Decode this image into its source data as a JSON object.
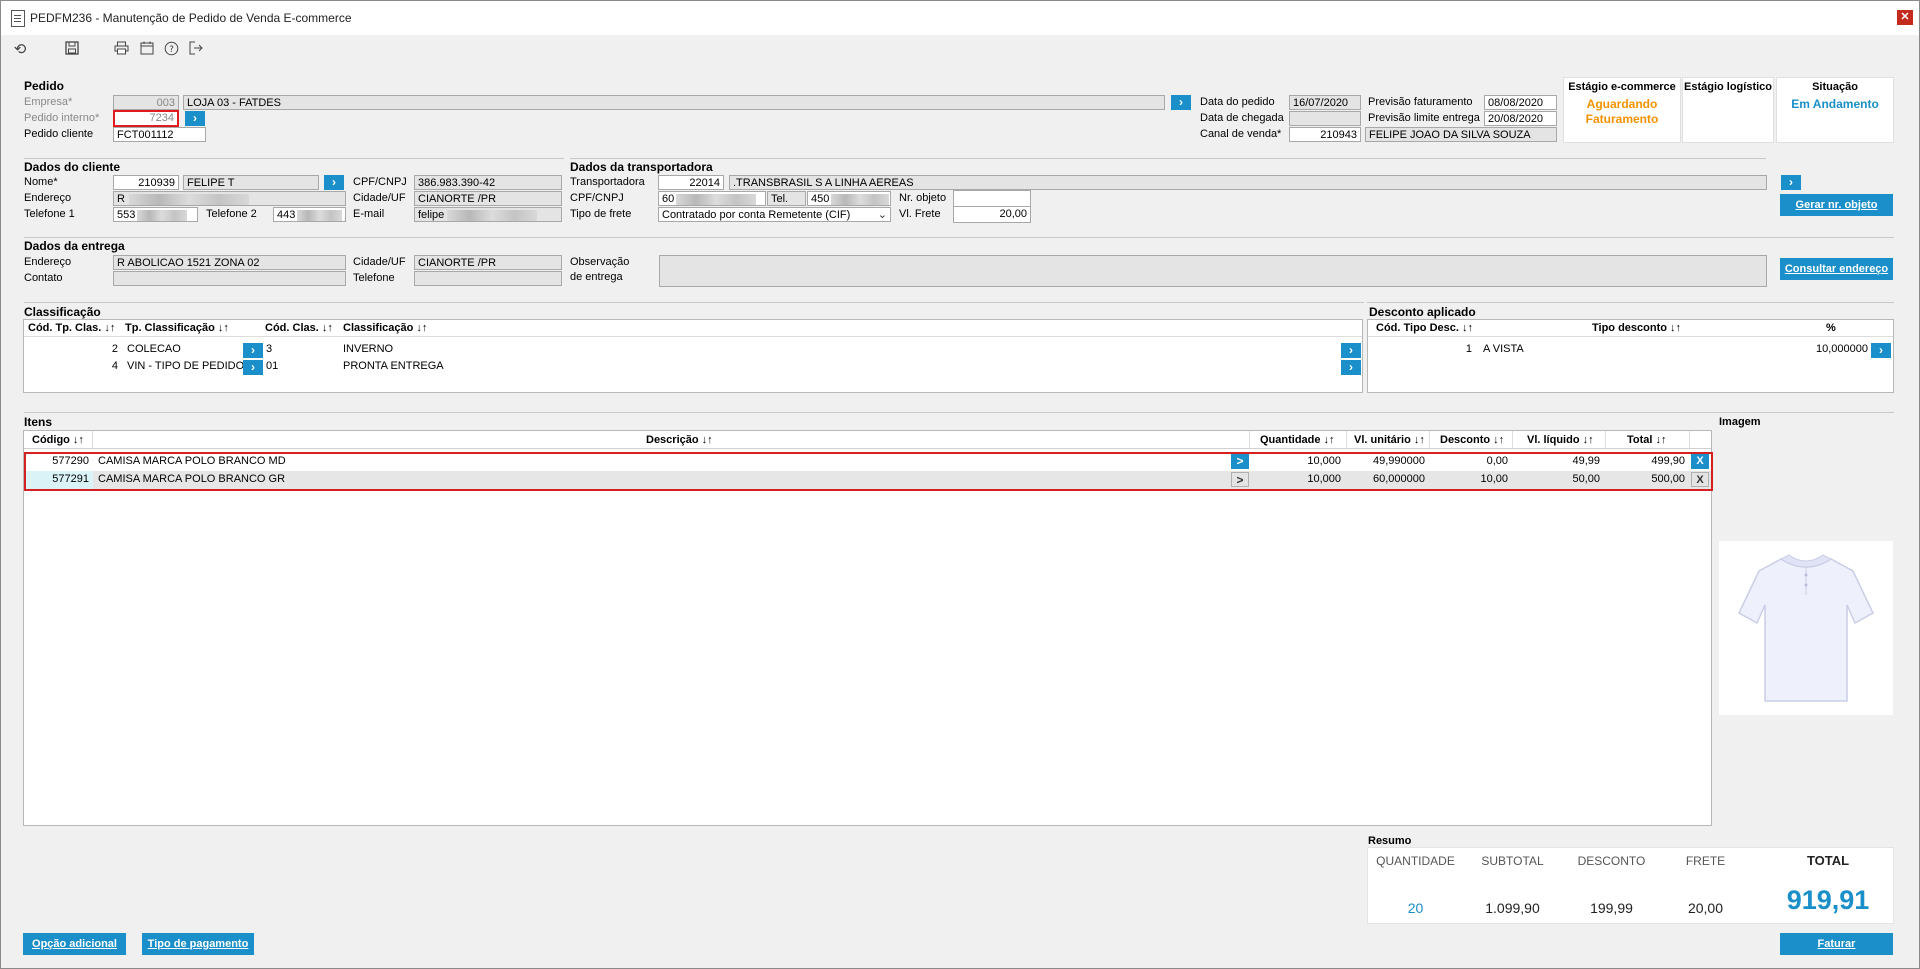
{
  "window": {
    "title": "PEDFM236 - Manutenção de Pedido de Venda E-commerce",
    "close_label": "✕"
  },
  "toolbar": [
    "refresh-icon",
    "save-icon",
    "print-icon",
    "calendar-icon",
    "help-icon",
    "exit-icon"
  ],
  "pedido": {
    "section": "Pedido",
    "empresa_label": "Empresa*",
    "empresa_code": "003",
    "empresa_name": "LOJA 03 - FATDES",
    "pedido_interno_label": "Pedido interno*",
    "pedido_interno": "7234",
    "pedido_cliente_label": "Pedido cliente",
    "pedido_cliente": "FCT001112",
    "data_pedido_label": "Data do pedido",
    "data_pedido": "16/07/2020",
    "data_chegada_label": "Data de chegada",
    "data_chegada": "",
    "canal_label": "Canal de venda*",
    "canal_code": "210943",
    "canal_name": "FELIPE JOAO DA SILVA SOUZA",
    "prev_fat_label": "Previsão faturamento",
    "prev_fat": "08/08/2020",
    "prev_limite_label": "Previsão limite entrega",
    "prev_limite": "20/08/2020"
  },
  "status": {
    "ecommerce_title": "Estágio e-commerce",
    "ecommerce_value_1": "Aguardando",
    "ecommerce_value_2": "Faturamento",
    "logistico_title": "Estágio logístico",
    "logistico_value": "",
    "situacao_title": "Situação",
    "situacao_value": "Em Andamento",
    "orange": "#f39200",
    "blue": "#1a8fc9"
  },
  "cliente": {
    "section": "Dados do cliente",
    "nome_label": "Nome*",
    "nome_code": "210939",
    "nome": "FELIPE T",
    "endereco_label": "Endereço",
    "endereco": "R",
    "tel1_label": "Telefone 1",
    "tel1": "553",
    "tel2_label": "Telefone 2",
    "tel2": "443",
    "cpf_label": "CPF/CNPJ",
    "cpf": "386.983.390-42",
    "cidade_label": "Cidade/UF",
    "cidade": "CIANORTE /PR",
    "email_label": "E-mail",
    "email": "felipe"
  },
  "transportadora": {
    "section": "Dados da transportadora",
    "transp_label": "Transportadora",
    "transp_code": "22014",
    "transp_name": ".TRANSBRASIL S A LINHA AEREAS",
    "cpf_label": "CPF/CNPJ",
    "cpf": "60",
    "tel_label": "Tel.",
    "tel": "450",
    "frete_label": "Tipo de frete",
    "frete": "Contratado por conta Remetente (CIF)",
    "nr_objeto_label": "Nr. objeto",
    "nr_objeto": "",
    "vl_frete_label": "Vl. Frete",
    "vl_frete": "20,00",
    "gerar_btn": "Gerar nr. objeto"
  },
  "entrega": {
    "section": "Dados da entrega",
    "endereco_label": "Endereço",
    "endereco": "R ABOLICAO 1521  ZONA 02",
    "contato_label": "Contato",
    "contato": "",
    "cidade_label": "Cidade/UF",
    "cidade": "CIANORTE /PR",
    "telefone_label": "Telefone",
    "telefone": "",
    "obs_label_1": "Observação",
    "obs_label_2": "de entrega",
    "obs": "",
    "consultar_btn": "Consultar endereço"
  },
  "classificacao": {
    "section": "Classificação",
    "headers": [
      "Cód. Tp. Clas. ↓↑",
      "Tp. Classificação ↓↑",
      "Cód. Clas. ↓↑",
      "Classificação ↓↑"
    ],
    "rows": [
      {
        "cod_tp": "2",
        "tp": "COLECAO",
        "cod": "3",
        "clas": "INVERNO"
      },
      {
        "cod_tp": "4",
        "tp": "VIN - TIPO DE PEDIDO",
        "cod": "01",
        "clas": "PRONTA ENTREGA"
      }
    ]
  },
  "desconto": {
    "section": "Desconto aplicado",
    "headers": [
      "Cód. Tipo Desc. ↓↑",
      "Tipo desconto ↓↑",
      "%"
    ],
    "rows": [
      {
        "cod": "1",
        "tipo": "A VISTA",
        "pct": "10,000000"
      }
    ]
  },
  "itens": {
    "section": "Itens",
    "headers": [
      "Código ↓↑",
      "Descrição ↓↑",
      "Quantidade ↓↑",
      "Vl. unitário ↓↑",
      "Desconto ↓↑",
      "Vl. líquido ↓↑",
      "Total ↓↑"
    ],
    "rows": [
      {
        "codigo": "577290",
        "descricao": "CAMISA MARCA POLO BRANCO MD",
        "qtd": "10,000",
        "vl_unit": "49,990000",
        "desconto": "0,00",
        "vl_liq": "49,99",
        "total": "499,90"
      },
      {
        "codigo": "577291",
        "descricao": "CAMISA MARCA POLO BRANCO GR",
        "qtd": "10,000",
        "vl_unit": "60,000000",
        "desconto": "10,00",
        "vl_liq": "50,00",
        "total": "500,00"
      }
    ],
    "remove_label": "X",
    "go_label": ">"
  },
  "imagem": {
    "section": "Imagem"
  },
  "resumo": {
    "section": "Resumo",
    "quantidade_label": "QUANTIDADE",
    "quantidade": "20",
    "subtotal_label": "SUBTOTAL",
    "subtotal": "1.099,90",
    "desconto_label": "DESCONTO",
    "desconto": "199,99",
    "frete_label": "FRETE",
    "frete": "20,00",
    "total_label": "TOTAL",
    "total": "919,91"
  },
  "footer": {
    "opcao_btn": "Opção adicional",
    "tipo_pag_btn": "Tipo de pagamento",
    "faturar_btn": "Faturar"
  }
}
